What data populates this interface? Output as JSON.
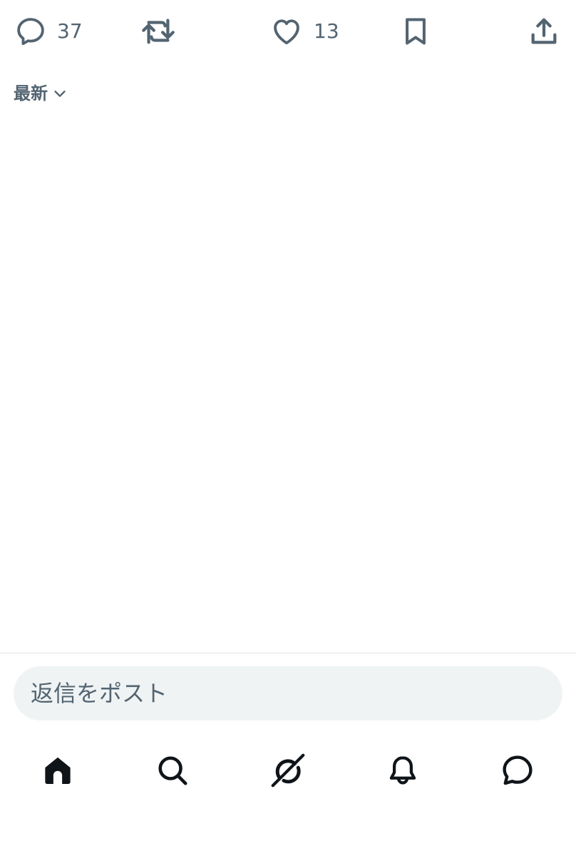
{
  "actions": {
    "reply": {
      "count": "37",
      "icon": "reply-icon"
    },
    "repost": {
      "icon": "repost-icon"
    },
    "like": {
      "count": "13",
      "icon": "heart-icon"
    },
    "bookmark": {
      "icon": "bookmark-icon"
    },
    "share": {
      "icon": "share-icon"
    }
  },
  "sort": {
    "label": "最新",
    "icon": "chevron-down-icon"
  },
  "reply_box": {
    "placeholder": "返信をポスト"
  },
  "tabs": [
    {
      "icon": "home-icon",
      "active": true
    },
    {
      "icon": "search-icon",
      "active": false
    },
    {
      "icon": "grok-icon",
      "active": false
    },
    {
      "icon": "bell-icon",
      "active": false
    },
    {
      "icon": "messages-icon",
      "active": false
    }
  ],
  "colors": {
    "icon_gray": "#536471",
    "icon_dark": "#0f1419",
    "input_bg": "#eff3f4",
    "divider": "#dfe3e6"
  }
}
